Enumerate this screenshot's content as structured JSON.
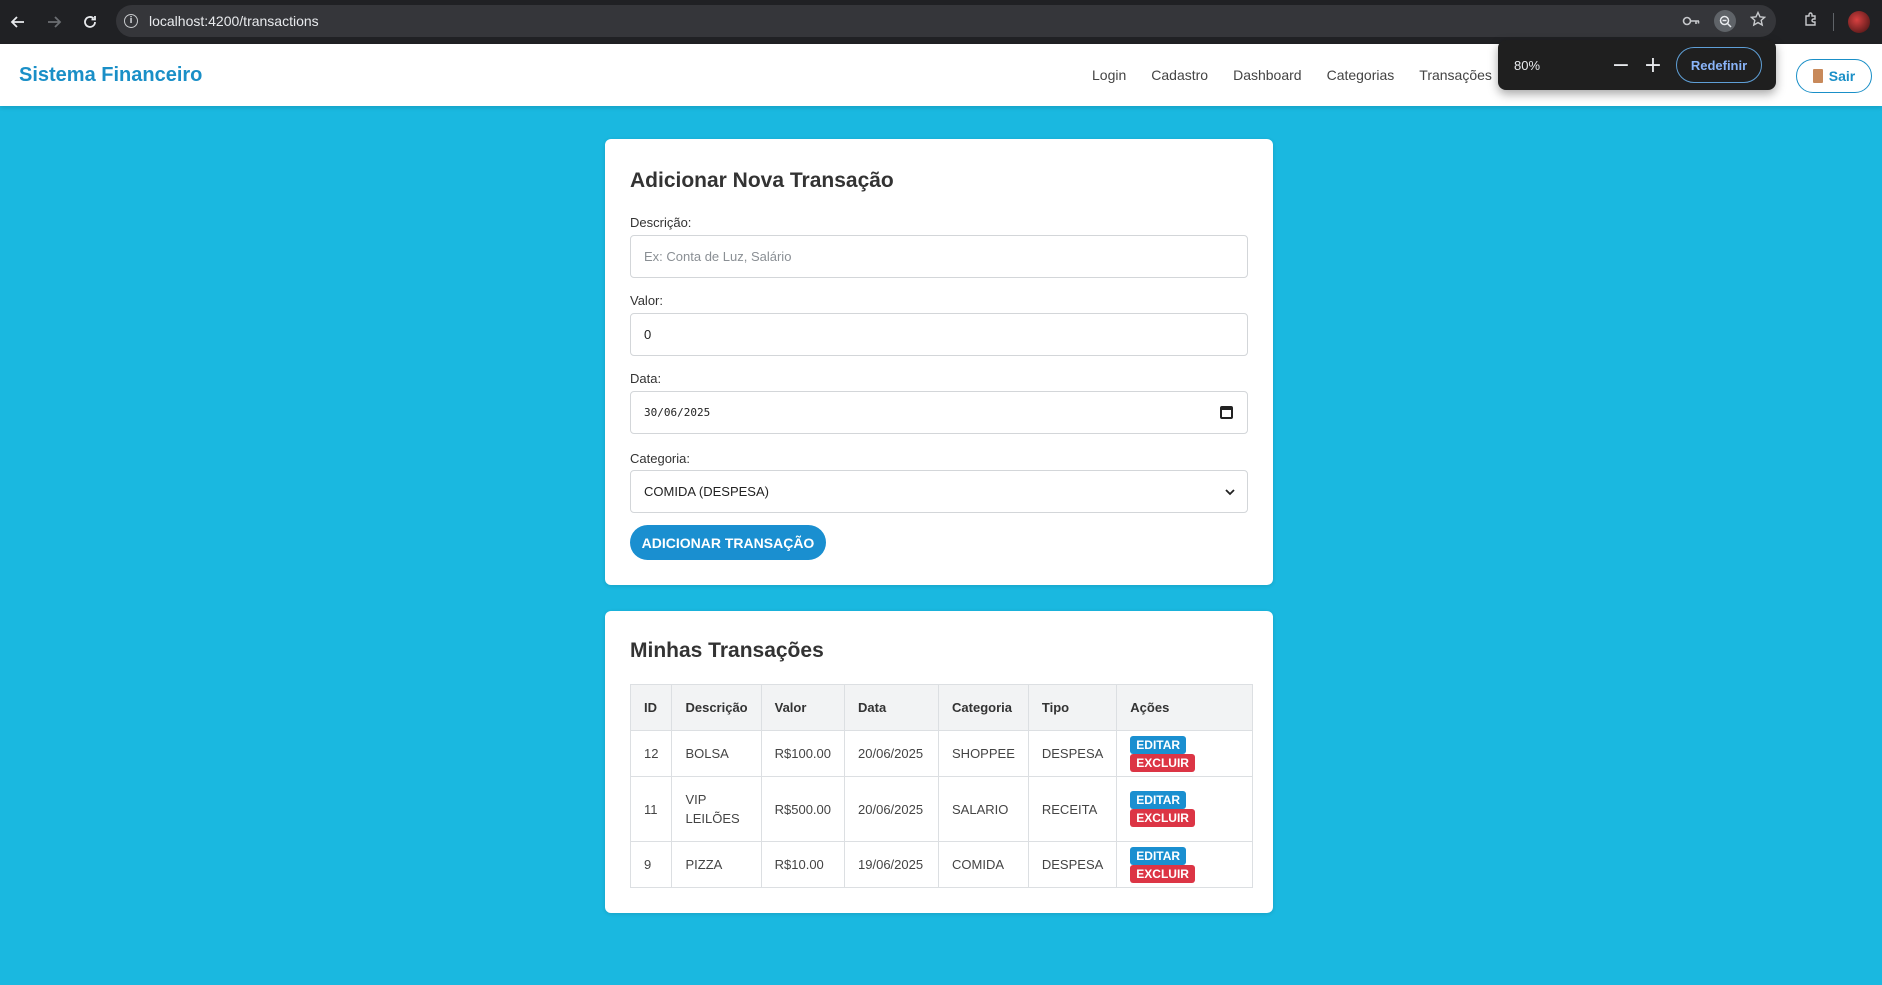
{
  "browser": {
    "url": "localhost:4200/transactions",
    "zoom": {
      "percent": "80%",
      "minus": "−",
      "plus": "+",
      "reset_label": "Redefinir"
    }
  },
  "navbar": {
    "brand": "Sistema Financeiro",
    "links": [
      "Login",
      "Cadastro",
      "Dashboard",
      "Categorias",
      "Transações"
    ],
    "logout_label": "Sair"
  },
  "form": {
    "title": "Adicionar Nova Transação",
    "description_label": "Descrição:",
    "description_placeholder": "Ex: Conta de Luz, Salário",
    "value_label": "Valor:",
    "value": "0",
    "date_label": "Data:",
    "date": "30/06/2025",
    "category_label": "Categoria:",
    "category_selected": "COMIDA (DESPESA)",
    "submit_label": "ADICIONAR TRANSAÇÃO"
  },
  "list": {
    "title": "Minhas Transações",
    "columns": [
      "ID",
      "Descrição",
      "Valor",
      "Data",
      "Categoria",
      "Tipo",
      "Ações"
    ],
    "edit_label": "EDITAR",
    "delete_label": "EXCLUIR",
    "rows": [
      {
        "id": "12",
        "descricao": "BOLSA",
        "valor": "R$100.00",
        "data": "20/06/2025",
        "categoria": "SHOPPEE",
        "tipo": "DESPESA"
      },
      {
        "id": "11",
        "descricao": "VIP LEILÕES",
        "valor": "R$500.00",
        "data": "20/06/2025",
        "categoria": "SALARIO",
        "tipo": "RECEITA"
      },
      {
        "id": "9",
        "descricao": "PIZZA",
        "valor": "R$10.00",
        "data": "19/06/2025",
        "categoria": "COMIDA",
        "tipo": "DESPESA"
      }
    ]
  },
  "colors": {
    "background": "#1ab8e0",
    "primary": "#1a8fd0",
    "danger": "#dc3545"
  }
}
